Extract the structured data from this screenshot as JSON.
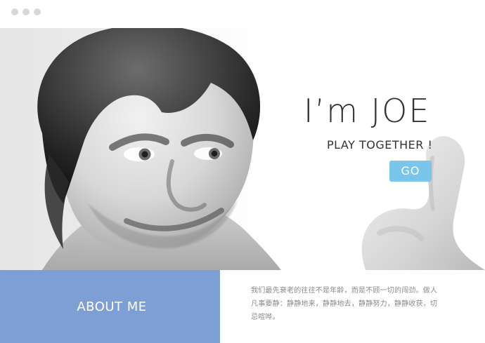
{
  "hero": {
    "title": "I’m JOE",
    "subtitle": "PLAY TOGETHER !",
    "go_label": "GO"
  },
  "about": {
    "label": "ABOUT ME",
    "description": "我们最先衰老的往往不是年龄，而是不顾一切的闯劲。做人凡事要静：静静地来，静静地去，静静努力，静静收获，切忌喧哗。"
  },
  "colors": {
    "about_background": "#7e9fd6",
    "go_button": "#7ac6ea"
  }
}
